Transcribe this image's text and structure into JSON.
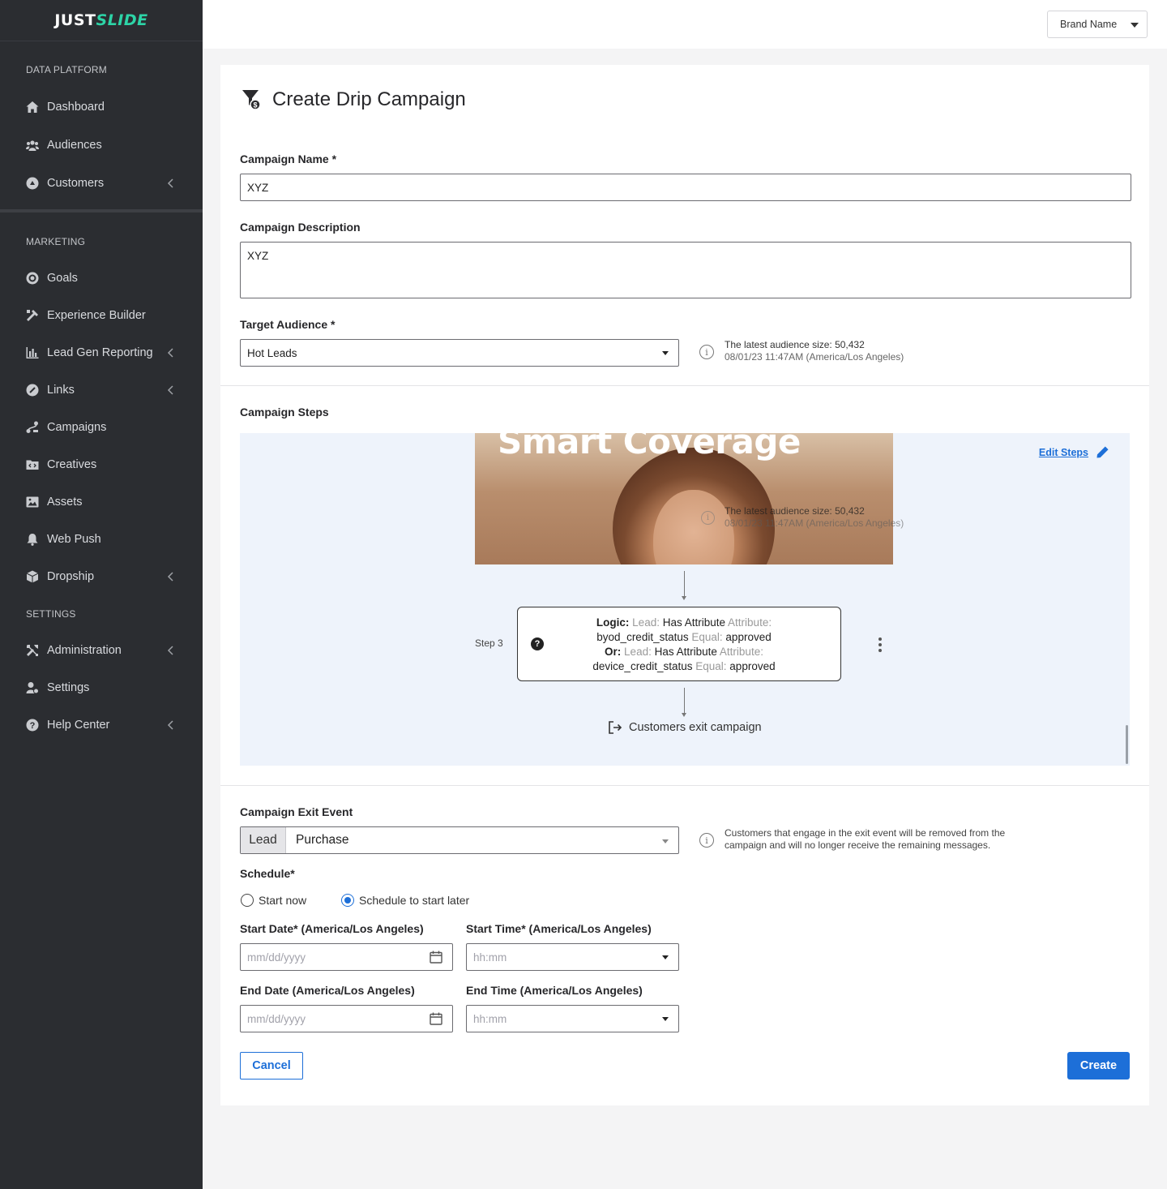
{
  "logo": {
    "part1": "JUST",
    "part2": "SLIDE"
  },
  "sidebar": {
    "sections": [
      "DATA PLATFORM",
      "MARKETING",
      "SETTINGS"
    ],
    "items": [
      {
        "label": "Dashboard",
        "icon": "home-icon"
      },
      {
        "label": "Audiences",
        "icon": "users-icon"
      },
      {
        "label": "Customers",
        "icon": "customers-icon",
        "expandable": true
      },
      {
        "label": "Goals",
        "icon": "target-icon"
      },
      {
        "label": "Experience Builder",
        "icon": "tools-icon"
      },
      {
        "label": "Lead Gen Reporting",
        "icon": "bar-chart-icon",
        "expandable": true
      },
      {
        "label": "Links",
        "icon": "link-icon",
        "expandable": true
      },
      {
        "label": "Campaigns",
        "icon": "route-icon"
      },
      {
        "label": "Creatives",
        "icon": "folder-code-icon"
      },
      {
        "label": "Assets",
        "icon": "image-icon"
      },
      {
        "label": "Web Push",
        "icon": "bell-icon"
      },
      {
        "label": "Dropship",
        "icon": "box-icon",
        "expandable": true
      },
      {
        "label": "Administration",
        "icon": "wrench-icon",
        "expandable": true
      },
      {
        "label": "Settings",
        "icon": "user-gear-icon"
      },
      {
        "label": "Help Center",
        "icon": "help-icon",
        "expandable": true
      }
    ]
  },
  "header": {
    "brand_select": "Brand Name"
  },
  "form": {
    "title": "Create Drip Campaign",
    "campaign_name_label": "Campaign Name *",
    "campaign_name_value": "XYZ",
    "campaign_description_label": "Campaign Description",
    "campaign_description_value": "XYZ",
    "target_audience_label": "Target Audience *",
    "target_audience_value": "Hot Leads",
    "audience_info_line1": "The latest audience size: 50,432",
    "audience_info_line2": "08/01/23 11:47AM (America/Los Angeles)",
    "campaign_steps_label": "Campaign Steps",
    "exit_event_label": "Campaign Exit Event",
    "exit_event_prefix": "Lead",
    "exit_event_value": "Purchase",
    "exit_info_line1": "Customers that engage in the exit event will be removed from the",
    "exit_info_line2": "campaign and will no longer receive the remaining messages.",
    "schedule_label": "Schedule*",
    "schedule_options": [
      "Start now",
      "Schedule to start later"
    ],
    "schedule_selected": "Schedule to start later",
    "start_date_label": "Start Date* (America/Los Angeles)",
    "start_time_label": "Start Time* (America/Los Angeles)",
    "end_date_label": "End Date (America/Los Angeles)",
    "end_time_label": "End Time (America/Los Angeles)",
    "date_placeholder": "mm/dd/yyyy",
    "time_placeholder": "hh:mm",
    "cancel_label": "Cancel",
    "create_label": "Create"
  },
  "steps": {
    "edit_label": "Edit Steps",
    "hero_text": "Smart Coverage",
    "overlay_line1": "The latest audience size: 50,432",
    "overlay_line2": "08/01/23 11:47AM (America/Los Angeles)",
    "step3_label": "Step 3",
    "logic": {
      "k1": "Logic:",
      "g1": "Lead:",
      "t1": "Has Attribute",
      "g2": "Attribute:",
      "t2": "byod_credit_status",
      "g3": "Equal:",
      "t3": "approved",
      "k2": "Or:",
      "g4": "Lead:",
      "t4": "Has Attribute",
      "g5": "Attribute:",
      "t5": "device_credit_status",
      "g6": "Equal:",
      "t6": "approved"
    },
    "exit_text": "Customers exit campaign"
  },
  "colors": {
    "sidebar_bg": "#2b2d31",
    "accent": "#1d6fd8",
    "logo_accent": "#2dd4a7",
    "steps_bg": "#eef3fb"
  }
}
